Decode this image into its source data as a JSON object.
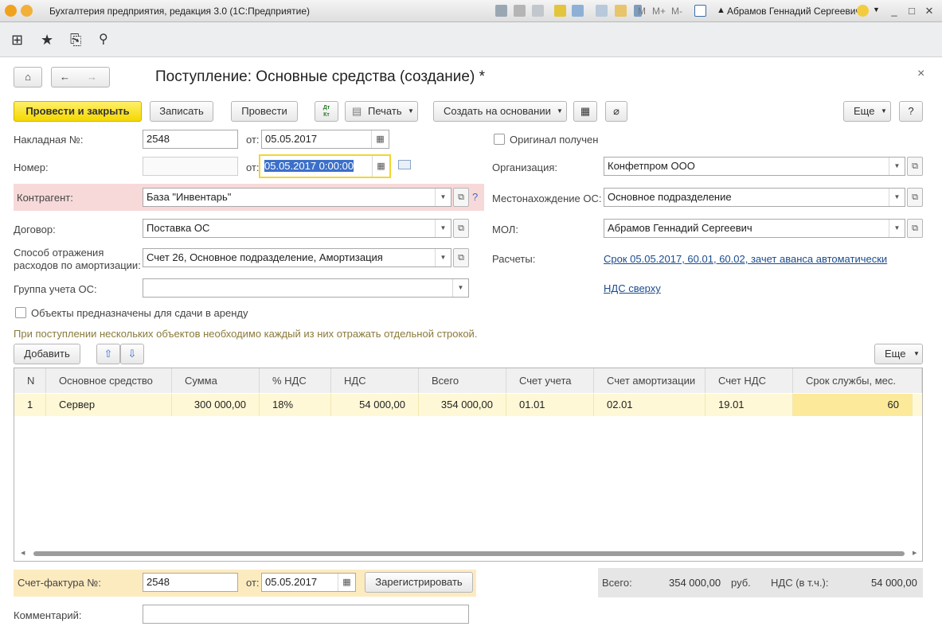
{
  "window": {
    "title": "Бухгалтерия предприятия, редакция 3.0 (1С:Предприятие)",
    "memory_buttons": [
      "M",
      "M+",
      "M-"
    ],
    "user": "Абрамов Геннадий Сергеевич"
  },
  "form": {
    "title": "Поступление: Основные средства (создание) *",
    "close": "×"
  },
  "commandbar": {
    "post_close": "Провести и закрыть",
    "save": "Записать",
    "post": "Провести",
    "dtkt": "Дт\nКт",
    "print": "Печать",
    "create_based": "Создать на основании",
    "more": "Еще",
    "help": "?"
  },
  "fields": {
    "invoice_label": "Накладная №:",
    "invoice_value": "2548",
    "from_label": "от:",
    "invoice_date": "05.05.2017",
    "number_label": "Номер:",
    "number_value": "",
    "doc_date": "05.05.2017  0:00:00",
    "contractor_label": "Контрагент:",
    "contractor_value": "База \"Инвентарь\"",
    "contractor_hint": "?",
    "contract_label": "Договор:",
    "contract_value": "Поставка ОС",
    "expense_label": "Способ отражения\nрасходов по амортизации:",
    "expense_value": "Счет 26, Основное подразделение, Амортизация",
    "group_label": "Группа учета ОС:",
    "group_value": "",
    "rent_label": "Объекты предназначены для сдачи в аренду",
    "original_label": "Оригинал получен",
    "org_label": "Организация:",
    "org_value": "Конфетпром ООО",
    "location_label": "Местонахождение ОС:",
    "location_value": "Основное подразделение",
    "mol_label": "МОЛ:",
    "mol_value": "Абрамов Геннадий Сергеевич",
    "settlements_label": "Расчеты:",
    "settlements_link": "Срок 05.05.2017, 60.01, 60.02, зачет аванса автоматически",
    "vat_link": "НДС сверху",
    "info_text": "При поступлении нескольких объектов необходимо каждый из них отражать отдельной строкой."
  },
  "table": {
    "add": "Добавить",
    "more": "Еще",
    "columns": [
      "N",
      "Основное средство",
      "Сумма",
      "% НДС",
      "НДС",
      "Всего",
      "Счет учета",
      "Счет амортизации",
      "Счет НДС",
      "Срок службы, мес."
    ],
    "rows": [
      [
        "1",
        "Сервер",
        "300 000,00",
        "18%",
        "54 000,00",
        "354 000,00",
        "01.01",
        "02.01",
        "19.01",
        "60"
      ]
    ]
  },
  "footer": {
    "sf_label": "Счет-фактура №:",
    "sf_value": "2548",
    "sf_from": "от:",
    "sf_date": "05.05.2017",
    "register": "Зарегистрировать",
    "total_label": "Всего:",
    "total_value": "354 000,00",
    "currency": "руб.",
    "vat_label": "НДС (в т.ч.):",
    "vat_value": "54 000,00",
    "comment_label": "Комментарий:",
    "comment_value": ""
  },
  "colors": {
    "accent_yellow": "#f5d800",
    "contractor_bg": "#f7d9d9",
    "row_highlight": "#fff8d6",
    "link": "#1a4c8f"
  }
}
